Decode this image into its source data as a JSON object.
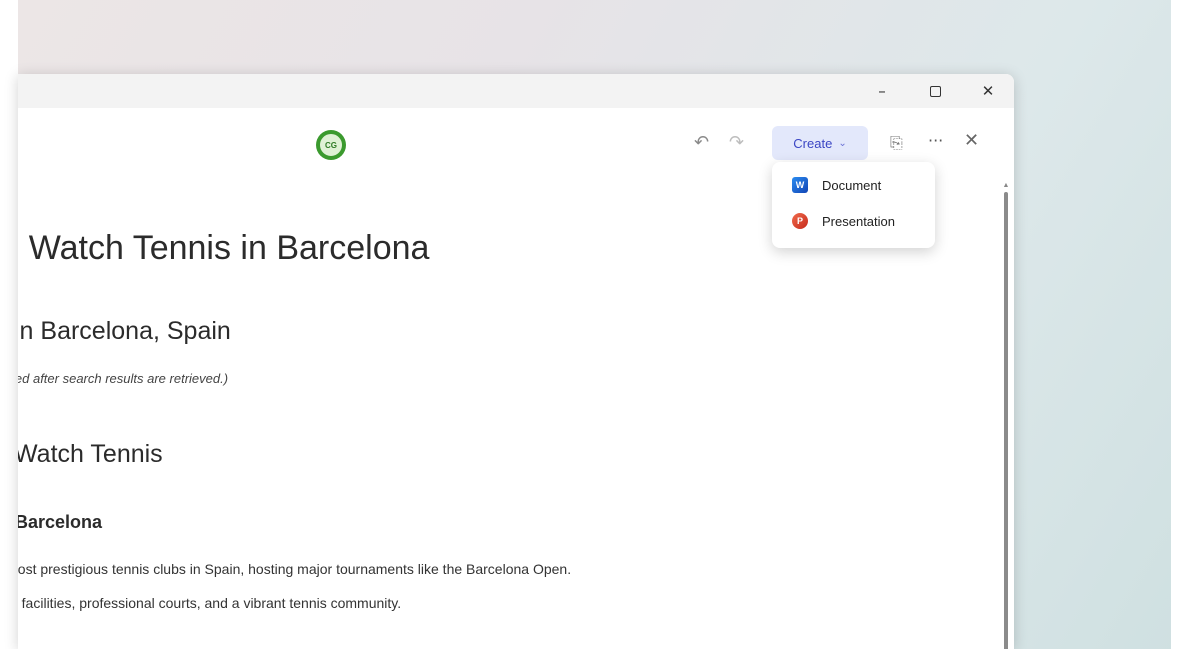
{
  "window": {
    "minimize_glyph": "–",
    "close_glyph": "✕"
  },
  "avatar": {
    "initials": "CG"
  },
  "toolbar": {
    "undo_glyph": "↶",
    "redo_glyph": "↷",
    "create_label": "Create",
    "create_chevron": "⌄",
    "share_glyph": "⎘",
    "more_glyph": "···",
    "close_glyph": "✕"
  },
  "create_menu": {
    "items": [
      {
        "label": "Document",
        "icon": "word-document-icon",
        "badge": "W"
      },
      {
        "label": "Presentation",
        "icon": "powerpoint-presentation-icon",
        "badge": "P"
      }
    ]
  },
  "document": {
    "title": "› Watch Tennis in Barcelona",
    "section_heading": "in Barcelona, Spain",
    "note": "led after search results are retrieved.)",
    "section2_heading": "Watch Tennis",
    "subheading": "Barcelona",
    "paragraph1": "nost prestigious tennis clubs in Spain, hosting major tournaments like the Barcelona Open.",
    "paragraph2": "ıt facilities, professional courts, and a vibrant tennis community."
  },
  "colors": {
    "create_bg": "#e3e8fb",
    "create_text": "#3b46c4",
    "avatar_green": "#3b9a2e"
  }
}
